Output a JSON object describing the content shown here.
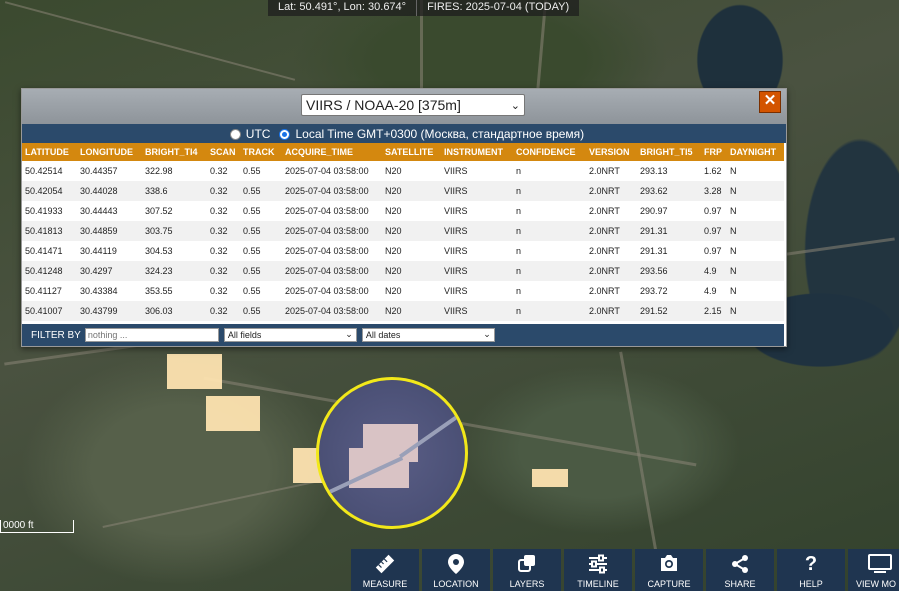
{
  "status": {
    "coords": "Lat: 50.491°, Lon: 30.674°",
    "fires": "FIRES: 2025-07-04 (TODAY)"
  },
  "popup": {
    "satellite_select": "VIIRS / NOAA-20 [375m]",
    "close_label": "✕",
    "time_utc": "UTC",
    "time_local": "Local Time GMT+0300 (Москва, стандартное время)",
    "time_selected": "local",
    "columns": [
      "LATITUDE",
      "LONGITUDE",
      "BRIGHT_TI4",
      "SCAN",
      "TRACK",
      "ACQUIRE_TIME",
      "SATELLITE",
      "INSTRUMENT",
      "CONFIDENCE",
      "VERSION",
      "BRIGHT_TI5",
      "FRP",
      "DAYNIGHT"
    ],
    "rows": [
      [
        "50.42514",
        "30.44357",
        "322.98",
        "0.32",
        "0.55",
        "2025-07-04 03:58:00",
        "N20",
        "VIIRS",
        "n",
        "2.0NRT",
        "293.13",
        "1.62",
        "N"
      ],
      [
        "50.42054",
        "30.44028",
        "338.6",
        "0.32",
        "0.55",
        "2025-07-04 03:58:00",
        "N20",
        "VIIRS",
        "n",
        "2.0NRT",
        "293.62",
        "3.28",
        "N"
      ],
      [
        "50.41933",
        "30.44443",
        "307.52",
        "0.32",
        "0.55",
        "2025-07-04 03:58:00",
        "N20",
        "VIIRS",
        "n",
        "2.0NRT",
        "290.97",
        "0.97",
        "N"
      ],
      [
        "50.41813",
        "30.44859",
        "303.75",
        "0.32",
        "0.55",
        "2025-07-04 03:58:00",
        "N20",
        "VIIRS",
        "n",
        "2.0NRT",
        "291.31",
        "0.97",
        "N"
      ],
      [
        "50.41471",
        "30.44119",
        "304.53",
        "0.32",
        "0.55",
        "2025-07-04 03:58:00",
        "N20",
        "VIIRS",
        "n",
        "2.0NRT",
        "291.31",
        "0.97",
        "N"
      ],
      [
        "50.41248",
        "30.4297",
        "324.23",
        "0.32",
        "0.55",
        "2025-07-04 03:58:00",
        "N20",
        "VIIRS",
        "n",
        "2.0NRT",
        "293.56",
        "4.9",
        "N"
      ],
      [
        "50.41127",
        "30.43384",
        "353.55",
        "0.32",
        "0.55",
        "2025-07-04 03:58:00",
        "N20",
        "VIIRS",
        "n",
        "2.0NRT",
        "293.72",
        "4.9",
        "N"
      ],
      [
        "50.41007",
        "30.43799",
        "306.03",
        "0.32",
        "0.55",
        "2025-07-04 03:58:00",
        "N20",
        "VIIRS",
        "n",
        "2.0NRT",
        "291.52",
        "2.15",
        "N"
      ]
    ],
    "filter": {
      "label": "FILTER BY",
      "placeholder": "nothing ...",
      "field_select": "All fields",
      "date_select": "All dates"
    }
  },
  "map": {
    "scale_label": "0000 ft"
  },
  "toolbar": [
    {
      "label": "MEASURE",
      "icon": "ruler-icon"
    },
    {
      "label": "LOCATION",
      "icon": "location-pin-icon"
    },
    {
      "label": "LAYERS",
      "icon": "layers-icon"
    },
    {
      "label": "TIMELINE",
      "icon": "sliders-icon"
    },
    {
      "label": "CAPTURE",
      "icon": "camera-icon"
    },
    {
      "label": "SHARE",
      "icon": "share-icon"
    },
    {
      "label": "HELP",
      "icon": "help-icon"
    },
    {
      "label": "VIEW MO",
      "icon": "monitor-icon"
    }
  ],
  "colors": {
    "header_orange": "#d4880f",
    "panel_blue": "#2b4a6b",
    "toolbar_bg": "#1f3550",
    "close_red": "#d35400",
    "highlight_circle": "#f2e81a"
  }
}
